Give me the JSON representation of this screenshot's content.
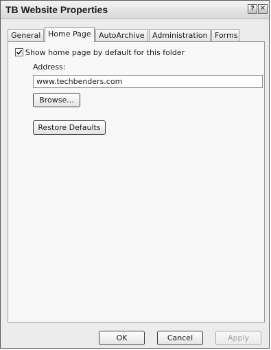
{
  "window": {
    "title": "TB Website Properties",
    "help_glyph": "?",
    "close_glyph": "✕"
  },
  "tabs": [
    {
      "label": "General",
      "active": false
    },
    {
      "label": "Home Page",
      "active": true
    },
    {
      "label": "AutoArchive",
      "active": false
    },
    {
      "label": "Administration",
      "active": false
    },
    {
      "label": "Forms",
      "active": false
    }
  ],
  "home_page": {
    "show_default_label": "Show home page by default for this folder",
    "show_default_checked": true,
    "address_label": "Address:",
    "address_value": "www.techbenders.com",
    "browse_label": "Browse...",
    "restore_label": "Restore Defaults"
  },
  "footer": {
    "ok_label": "OK",
    "cancel_label": "Cancel",
    "apply_label": "Apply",
    "apply_enabled": false
  },
  "icons": {
    "check": "check-icon",
    "help": "help-icon",
    "close": "close-icon"
  }
}
